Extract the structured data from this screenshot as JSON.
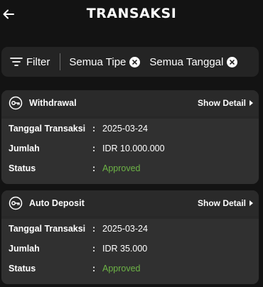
{
  "header": {
    "title": "TRANSAKSI",
    "back_icon": "arrow-left-icon"
  },
  "filter_bar": {
    "filter_label": "Filter",
    "chips": [
      {
        "label": "Semua Tipe"
      },
      {
        "label": "Semua Tanggal"
      }
    ]
  },
  "transactions": [
    {
      "type": "Withdrawal",
      "detail_label": "Show Detail",
      "rows": [
        {
          "key": "Tanggal Transaksi",
          "sep": ":",
          "value": "2025-03-24"
        },
        {
          "key": "Jumlah",
          "sep": ":",
          "value": "IDR 10.000.000"
        },
        {
          "key": "Status",
          "sep": ":",
          "value": "Approved"
        }
      ]
    },
    {
      "type": "Auto Deposit",
      "detail_label": "Show Detail",
      "rows": [
        {
          "key": "Tanggal Transaksi",
          "sep": ":",
          "value": "2025-03-24"
        },
        {
          "key": "Jumlah",
          "sep": ":",
          "value": "IDR 35.000"
        },
        {
          "key": "Status",
          "sep": ":",
          "value": "Approved"
        }
      ]
    }
  ],
  "colors": {
    "background": "#131313",
    "card": "#282828",
    "status_approved": "#6db346"
  }
}
